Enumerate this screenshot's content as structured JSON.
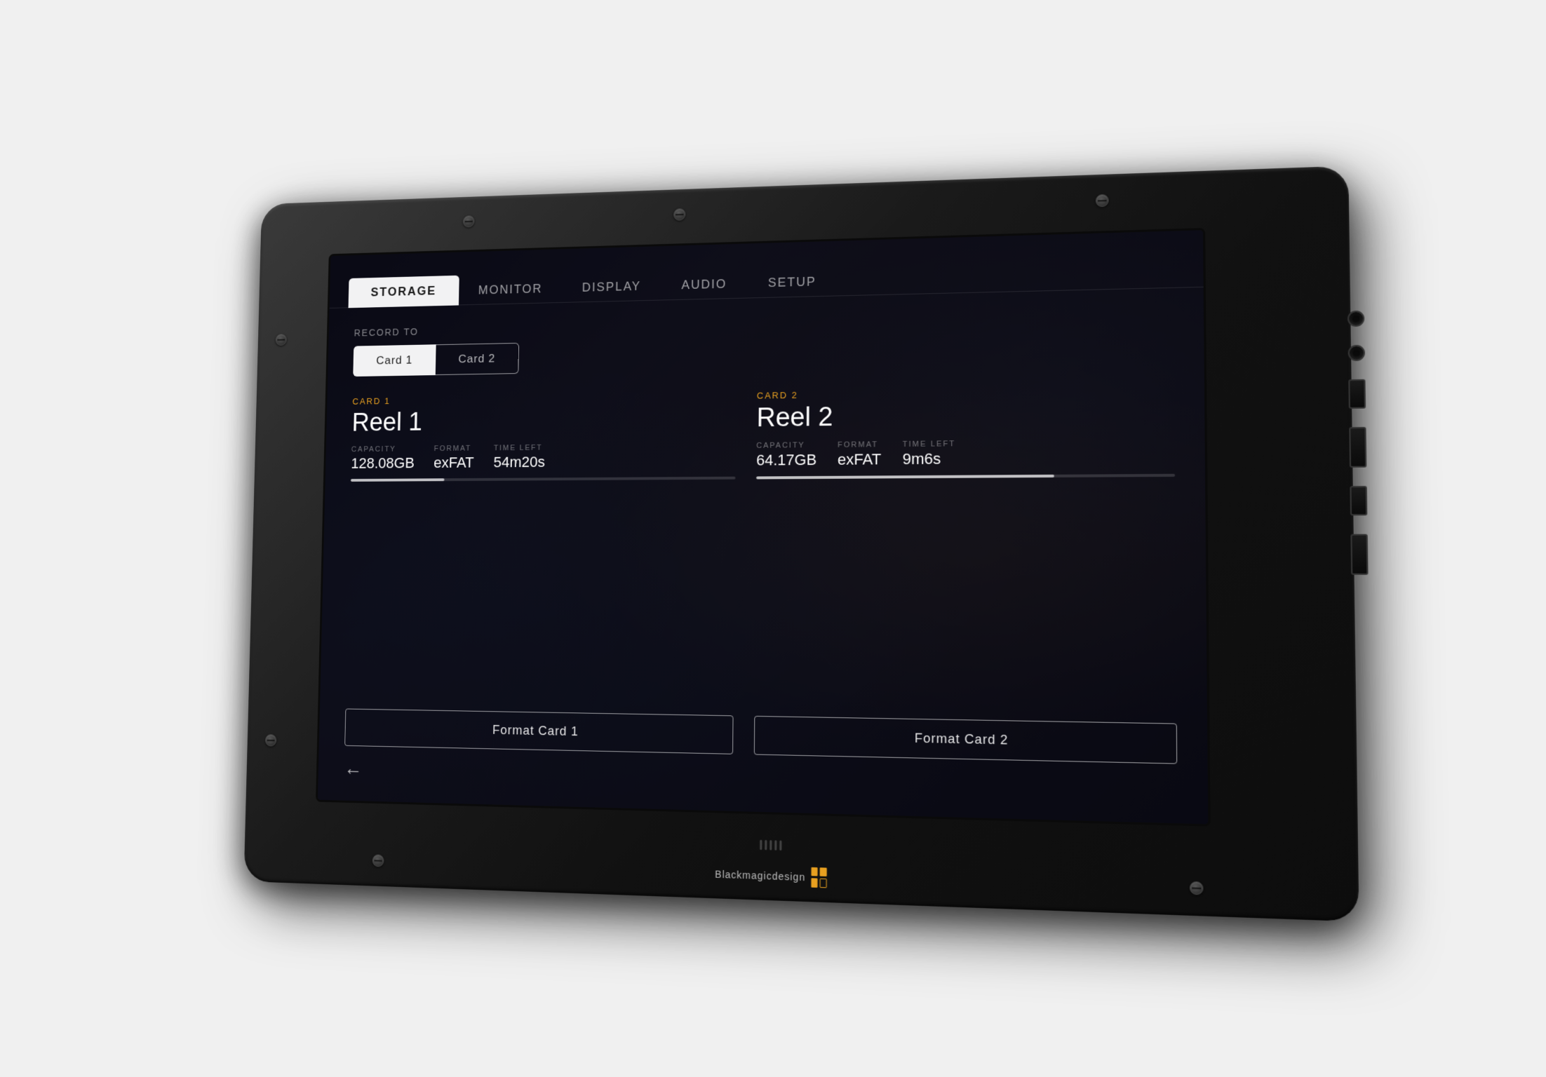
{
  "device": {
    "brand": "Blackmagicdesign"
  },
  "screen": {
    "nav": {
      "tabs": [
        {
          "id": "storage",
          "label": "STORAGE",
          "active": true
        },
        {
          "id": "monitor",
          "label": "MONITOR",
          "active": false
        },
        {
          "id": "display",
          "label": "DISPLAY",
          "active": false
        },
        {
          "id": "audio",
          "label": "AUDIO",
          "active": false
        },
        {
          "id": "setup",
          "label": "SETUP",
          "active": false
        }
      ]
    },
    "record_to": {
      "label": "RECORD TO",
      "options": [
        "Card 1",
        "Card 2"
      ],
      "selected": "Card 1"
    },
    "card1": {
      "label": "CARD 1",
      "name": "Reel 1",
      "capacity_label": "CAPACITY",
      "capacity_value": "128.08GB",
      "format_label": "FORMAT",
      "format_value": "exFAT",
      "time_left_label": "TIME LEFT",
      "time_left_value": "54m20s",
      "progress_pct": 25
    },
    "card2": {
      "label": "CARD 2",
      "name": "Reel 2",
      "capacity_label": "CAPACITY",
      "capacity_value": "64.17GB",
      "format_label": "FORMAT",
      "format_value": "exFAT",
      "time_left_label": "TIME LEFT",
      "time_left_value": "9m6s",
      "progress_pct": 72
    },
    "buttons": {
      "format_card1": "Format Card 1",
      "format_card2": "Format Card 2"
    },
    "back_arrow": "←"
  }
}
